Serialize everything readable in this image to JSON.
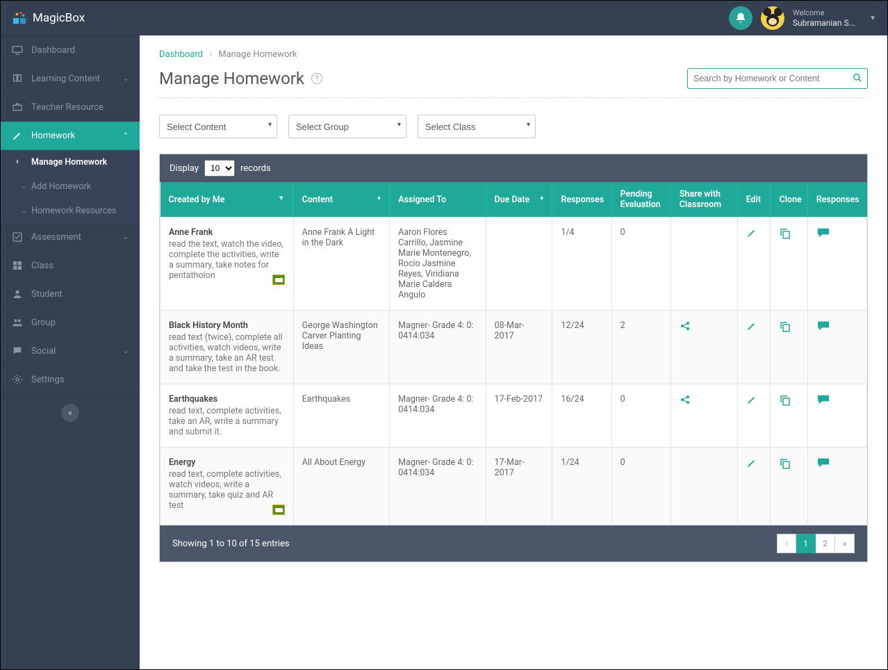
{
  "brand": "MagicBox",
  "welcome_label": "Welcome",
  "user_name": "Subramanian S...",
  "breadcrumb": {
    "root": "Dashboard",
    "sep": "›",
    "current": "Manage Homework"
  },
  "page_title": "Manage Homework",
  "search_placeholder": "Search by Homework or Content",
  "sidebar": [
    {
      "label": "Dashboard",
      "icon": "monitor"
    },
    {
      "label": "Learning Content",
      "icon": "book",
      "chev": "down"
    },
    {
      "label": "Teacher Resource",
      "icon": "briefcase"
    },
    {
      "label": "Homework",
      "icon": "pencil",
      "chev": "up",
      "active": true,
      "sub": [
        {
          "label": "Manage Homework",
          "active": true
        },
        {
          "label": "Add Homework"
        },
        {
          "label": "Homework Resources"
        }
      ]
    },
    {
      "label": "Assessment",
      "icon": "check",
      "chev": "down"
    },
    {
      "label": "Class",
      "icon": "grid"
    },
    {
      "label": "Student",
      "icon": "user"
    },
    {
      "label": "Group",
      "icon": "users"
    },
    {
      "label": "Social",
      "icon": "chat",
      "chev": "down"
    },
    {
      "label": "Settings",
      "icon": "cog"
    }
  ],
  "filters": {
    "content": "Select Content",
    "group": "Select Group",
    "class": "Select Class"
  },
  "display": {
    "pre": "Display",
    "value": "10",
    "post": "records"
  },
  "columns": [
    "Created by Me",
    "Content",
    "Assigned To",
    "Due Date",
    "Responses",
    "Pending Evaluation",
    "Share with Classroom",
    "Edit",
    "Clone",
    "Responses"
  ],
  "rows": [
    {
      "title": "Anne Frank",
      "desc": "read the text, watch the video, complete the activities, write a summary, take notes for pentatholon",
      "badge": true,
      "content": "Anne Frank A Light in the Dark",
      "assigned": "Aaron Flores Carrillo, Jasmine Marie Montenegro, Rocio Jasmine Reyes, Viridiana Marie Caldera Angulo",
      "due": "",
      "responses": "1/4",
      "pending": "0",
      "share": false
    },
    {
      "title": "Black History Month",
      "desc": "read text (twice), complete all activities, watch videos, write a summary, take an AR test and take the test in the book.",
      "content": "George Washington Carver Planting Ideas",
      "assigned": "Magner- Grade 4: 0: 0414:034",
      "due": "08-Mar-2017",
      "responses": "12/24",
      "pending": "2",
      "share": true
    },
    {
      "title": "Earthquakes",
      "desc": "read text, complete activities, take an AR, write a summary and submit it.",
      "content": "Earthquakes",
      "assigned": "Magner- Grade 4: 0: 0414:034",
      "due": "17-Feb-2017",
      "responses": "16/24",
      "pending": "0",
      "share": true
    },
    {
      "title": "Energy",
      "desc": "read text, complete activities, watch videos, write a summary, take quiz and AR test",
      "badge": true,
      "content": "All About Energy",
      "assigned": "Magner- Grade 4: 0: 0414:034",
      "due": "17-Mar-2017",
      "responses": "1/24",
      "pending": "0",
      "share": false
    }
  ],
  "footer_text": "Showing 1 to 10 of 15 entries",
  "pages": [
    "1",
    "2"
  ],
  "active_page": "1"
}
